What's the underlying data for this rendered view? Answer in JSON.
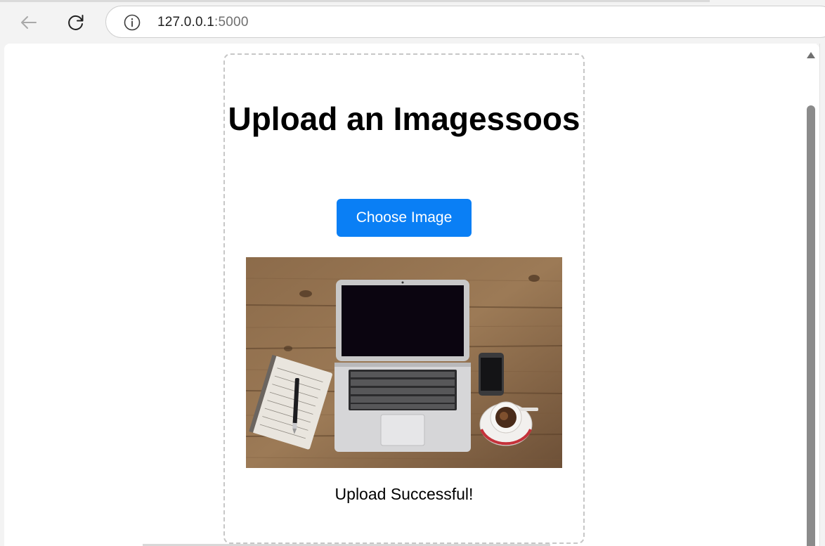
{
  "browser": {
    "url_host": "127.0.0.1",
    "url_port": ":5000"
  },
  "icons": {
    "back": "arrow-left-icon",
    "reload": "reload-icon",
    "info": "info-icon"
  },
  "page": {
    "title": "Upload an Imagessoos",
    "choose_button_label": "Choose Image",
    "status_message": "Upload Successful!",
    "preview_image_description": "laptop, notebook, pen, phone and coffee cup on wooden desk"
  },
  "colors": {
    "button_accent": "#0a7ff5",
    "card_border": "#c7c7c7"
  }
}
